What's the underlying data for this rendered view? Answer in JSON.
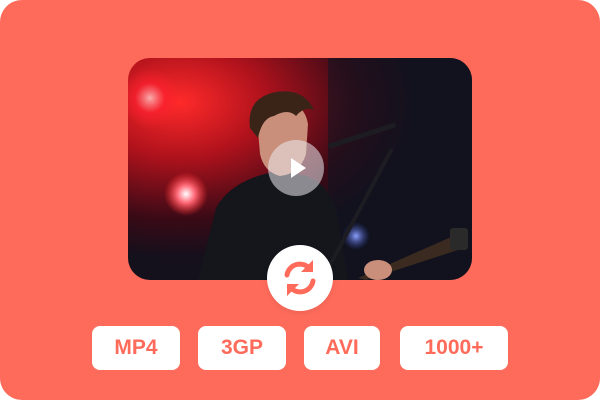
{
  "colors": {
    "background": "#FF6B5B",
    "pill_background": "#FFFFFF",
    "pill_text": "#FF6B5B",
    "icon_accent": "#FF6B5B"
  },
  "media": {
    "description_icon": "play-icon",
    "convert_icon": "refresh-arrows-icon"
  },
  "formats": [
    {
      "label": "MP4"
    },
    {
      "label": "3GP"
    },
    {
      "label": "AVI"
    },
    {
      "label": "1000+"
    }
  ]
}
